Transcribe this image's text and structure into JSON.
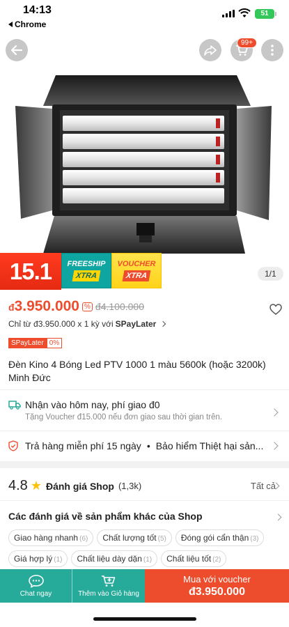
{
  "status": {
    "time": "14:13",
    "back_label": "Chrome",
    "battery": "51"
  },
  "hero": {
    "counter": "1/1",
    "cart_badge": "99+"
  },
  "promo": {
    "date": "15.1",
    "freeship": "FREESHIP",
    "freeship_sub": "XTRA",
    "voucher": "VOUCHER",
    "voucher_sub": "XTRA"
  },
  "price": {
    "currency": "đ",
    "current": "3.950.000",
    "old": "đ4.100.000"
  },
  "installment": {
    "text": "Chỉ từ đ3.950.000 x 1 kỳ với",
    "brand": "SPayLater"
  },
  "badges": {
    "spay": "SPayLater",
    "rate": "0%"
  },
  "product_title": "Đèn Kino 4 Bóng Led PTV 1000 1 màu 5600k (hoặc 3200k) Minh Đức",
  "shipping": {
    "title": "Nhận vào hôm nay, phí giao đ0",
    "subtitle": "Tặng Voucher đ15.000 nếu đơn giao sau thời gian trên."
  },
  "returns": {
    "text": "Trả hàng miễn phí 15 ngày",
    "insurance": "Bảo hiểm Thiệt hại sản..."
  },
  "rating": {
    "score": "4.8",
    "label": "Đánh giá Shop",
    "count": "(1,3k)",
    "see_all": "Tất cả"
  },
  "reviews": {
    "title": "Các đánh giá về sản phẩm khác của Shop",
    "chips": [
      {
        "label": "Giao hàng nhanh",
        "count": "(6)"
      },
      {
        "label": "Chất lượng tốt",
        "count": "(5)"
      },
      {
        "label": "Đóng gói cẩn thận",
        "count": "(3)"
      },
      {
        "label": "Giá hợp lý",
        "count": "(1)"
      },
      {
        "label": "Chất liệu dày dặn",
        "count": "(1)"
      },
      {
        "label": "Chất liệu tốt",
        "count": "(2)"
      }
    ]
  },
  "bottom": {
    "chat": "Chat ngay",
    "add_cart": "Thêm vào Giỏ hàng",
    "buy_line1": "Mua với voucher",
    "buy_line2": "đ3.950.000"
  },
  "colors": {
    "brand": "#ee4d2d",
    "teal": "#26aa99",
    "star": "#ffc107"
  }
}
